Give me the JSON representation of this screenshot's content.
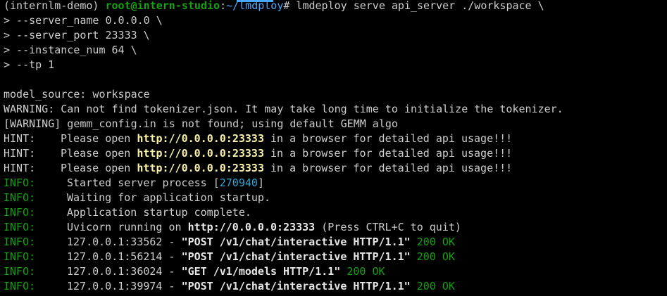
{
  "prompt": {
    "env": "(internlm-demo)",
    "user_host": "root@intern-studio",
    "sep": ":",
    "path": "~/lmdploy",
    "symbol": "#",
    "command": " lmdeploy serve api_server ./workspace \\"
  },
  "continuations": [
    "> --server_name 0.0.0.0 \\",
    "> --server_port 23333 \\",
    "> --instance_num 64 \\",
    "> --tp 1"
  ],
  "model_source": "model_source: workspace",
  "warning_tokenizer": "WARNING: Can not find tokenizer.json. It may take long time to initialize the tokenizer.",
  "warning_gemm": "[WARNING] gemm_config.in is not found; using default GEMM algo",
  "hints": [
    {
      "label": "HINT:",
      "pre": "Please open ",
      "url": "http://0.0.0.0:23333",
      "post": " in a browser for detailed api usage!!!"
    },
    {
      "label": "HINT:",
      "pre": "Please open ",
      "url": "http://0.0.0.0:23333",
      "post": " in a browser for detailed api usage!!!"
    },
    {
      "label": "HINT:",
      "pre": "Please open ",
      "url": "http://0.0.0.0:23333",
      "post": " in a browser for detailed api usage!!!"
    }
  ],
  "info_started": {
    "label": "INFO:",
    "pre": "Started server process [",
    "pid": "270940",
    "post": "]"
  },
  "info_waiting": {
    "label": "INFO:",
    "text": "Waiting for application startup."
  },
  "info_complete": {
    "label": "INFO:",
    "text": "Application startup complete."
  },
  "info_uvicorn": {
    "label": "INFO:",
    "pre": "Uvicorn running on ",
    "url": "http://0.0.0.0:23333",
    "post": " (Press CTRL+C to quit)"
  },
  "requests": [
    {
      "label": "INFO:",
      "client": "127.0.0.1:33562 - ",
      "request": "\"POST /v1/chat/interactive HTTP/1.1\"",
      "status": " 200 OK"
    },
    {
      "label": "INFO:",
      "client": "127.0.0.1:56214 - ",
      "request": "\"POST /v1/chat/interactive HTTP/1.1\"",
      "status": " 200 OK"
    },
    {
      "label": "INFO:",
      "client": "127.0.0.1:36024 - ",
      "request": "\"GET /v1/models HTTP/1.1\"",
      "status": " 200 OK"
    },
    {
      "label": "INFO:",
      "client": "127.0.0.1:39974 - ",
      "request": "\"POST /v1/chat/interactive HTTP/1.1\"",
      "status": " 200 OK"
    }
  ]
}
